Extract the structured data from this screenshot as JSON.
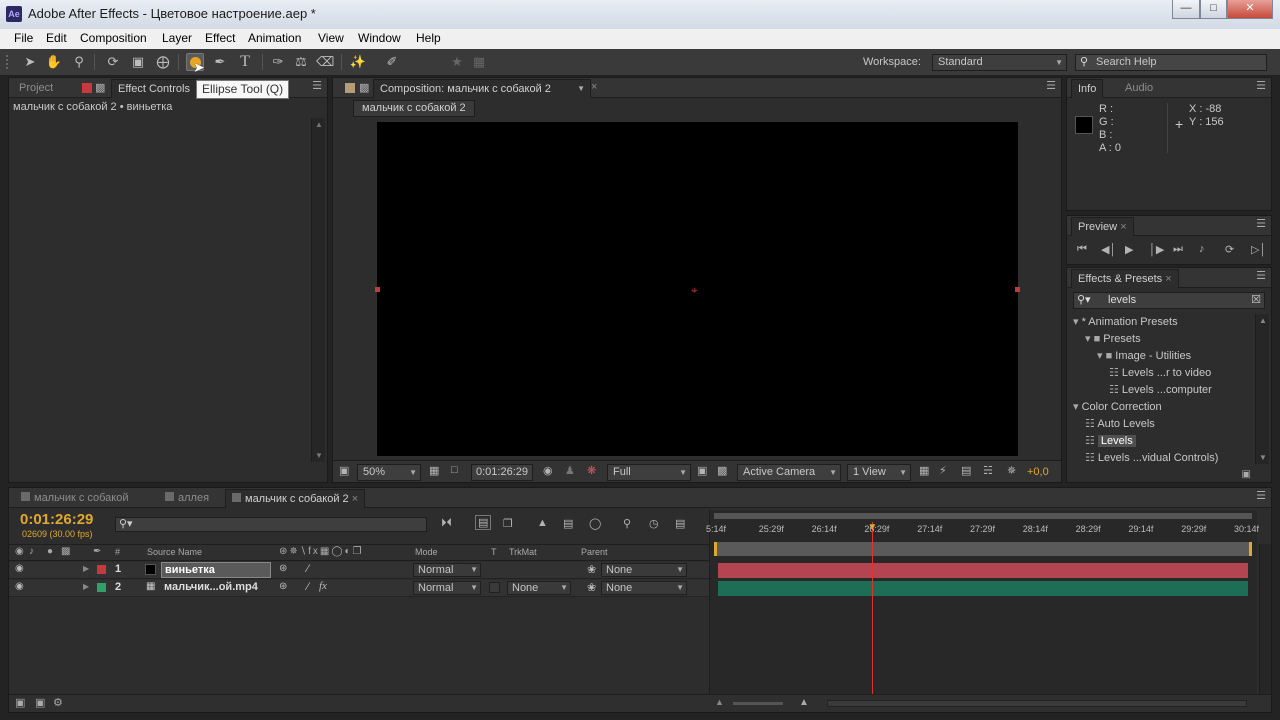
{
  "window": {
    "title": "Adobe After Effects - Цветовое настроение.aep *",
    "icon_text": "Ae"
  },
  "menu": [
    "File",
    "Edit",
    "Composition",
    "Layer",
    "Effect",
    "Animation",
    "View",
    "Window",
    "Help"
  ],
  "toolbar": {
    "tools": [
      "selection-tool",
      "hand-tool",
      "zoom-tool",
      "rotation-tool",
      "camera-orbit-tool",
      "pan-behind-tool",
      "ellipse-tool",
      "pen-tool",
      "type-tool",
      "brush-tool",
      "clone-stamp-tool",
      "eraser-tool",
      "roto-brush-tool",
      "puppet-tool"
    ],
    "tooltip": "Ellipse Tool (Q)",
    "workspace_label": "Workspace:",
    "workspace_value": "Standard",
    "search_placeholder": "Search Help"
  },
  "left_panel": {
    "tab_project": "Project",
    "tab_effect_controls": "Effect Controls",
    "breadcrumb": "мальчик с собакой 2 • виньетка"
  },
  "composition": {
    "tab": "Composition: мальчик с собакой 2",
    "sub_tab": "мальчик с собакой 2",
    "footer": {
      "zoom": "50%",
      "timecode": "0:01:26:29",
      "resolution": "Full",
      "camera": "Active Camera",
      "views": "1 View",
      "exposure": "+0,0"
    }
  },
  "info": {
    "tab_info": "Info",
    "tab_audio": "Audio",
    "r": "R :",
    "g": "G :",
    "b": "B :",
    "a": "A : 0",
    "x": "X : -88",
    "y": "Y : 156"
  },
  "preview": {
    "tab": "Preview"
  },
  "effects_presets": {
    "tab": "Effects & Presets",
    "search_value": "levels",
    "tree": [
      {
        "label": "* Animation Presets",
        "level": 0,
        "type": "folder-open"
      },
      {
        "label": "Presets",
        "level": 1,
        "type": "folder"
      },
      {
        "label": "Image - Utilities",
        "level": 2,
        "type": "folder"
      },
      {
        "label": "Levels ...r to video",
        "level": 3,
        "type": "preset"
      },
      {
        "label": "Levels ...computer",
        "level": 3,
        "type": "preset"
      },
      {
        "label": "Color Correction",
        "level": 0,
        "type": "category"
      },
      {
        "label": "Auto Levels",
        "level": 1,
        "type": "effect"
      },
      {
        "label": "Levels",
        "level": 1,
        "type": "effect",
        "selected": true
      },
      {
        "label": "Levels ...vidual Controls)",
        "level": 1,
        "type": "effect"
      }
    ]
  },
  "timeline": {
    "tabs": [
      "мальчик с собакой",
      "аллея",
      "мальчик с собакой 2"
    ],
    "current_time": "0:01:26:29",
    "frame_info": "02609 (30.00 fps)",
    "columns": {
      "num": "#",
      "source_name": "Source Name",
      "mode": "Mode",
      "t": "T",
      "trkmat": "TrkMat",
      "parent": "Parent"
    },
    "ruler": [
      "5:14f",
      "25:29f",
      "26:14f",
      "26:29f",
      "27:14f",
      "27:29f",
      "28:14f",
      "28:29f",
      "29:14f",
      "29:29f",
      "30:14f"
    ],
    "layers": [
      {
        "num": "1",
        "name": "виньетка",
        "mode": "Normal",
        "trkmat": "",
        "parent": "None",
        "color": "#c8393e",
        "bar": "#b2454f"
      },
      {
        "num": "2",
        "name": "мальчик...ой.mp4",
        "mode": "Normal",
        "trkmat": "None",
        "parent": "None",
        "color": "#2ea06a",
        "bar": "#1d6e54"
      }
    ],
    "playhead_position": 0.3
  }
}
